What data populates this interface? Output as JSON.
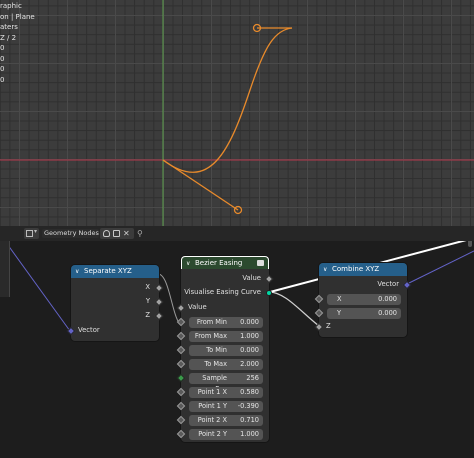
{
  "viewport": {
    "overlay_lines": [
      "raphic",
      "on | Plane",
      "aters",
      "Z / 2",
      "0",
      "0",
      "0",
      "0"
    ],
    "colors": {
      "curve": "#e88a2b",
      "x_axis": "#b3374b",
      "y_axis": "#5da04d"
    }
  },
  "header": {
    "editor_type_icon": "node-editor-icon",
    "tree_name": "Geometry Nodes",
    "pin_icon": "pin-icon"
  },
  "nodes": {
    "separate_xyz": {
      "title": "Separate XYZ",
      "outputs": [
        "X",
        "Y",
        "Z"
      ],
      "input_label": "Vector"
    },
    "bezier_easing": {
      "title": "Bezier Easing",
      "output_label": "Value",
      "visualise_label": "Visualise Easing Curve",
      "input_label": "Value",
      "fields": [
        {
          "label": "From Min",
          "value": "0.000"
        },
        {
          "label": "From Max",
          "value": "1.000"
        },
        {
          "label": "To Min",
          "value": "0.000"
        },
        {
          "label": "To Max",
          "value": "2.000"
        },
        {
          "label": "Sample Res",
          "value": "256"
        },
        {
          "label": "Point 1 X",
          "value": "0.580"
        },
        {
          "label": "Point 1 Y",
          "value": "-0.390"
        },
        {
          "label": "Point 2 X",
          "value": "0.710"
        },
        {
          "label": "Point 2 Y",
          "value": "1.000"
        }
      ]
    },
    "combine_xyz": {
      "title": "Combine XYZ",
      "output_label": "Vector",
      "fields": [
        {
          "label": "X",
          "value": "0.000"
        },
        {
          "label": "Y",
          "value": "0.000"
        }
      ],
      "z_label": "Z"
    }
  }
}
